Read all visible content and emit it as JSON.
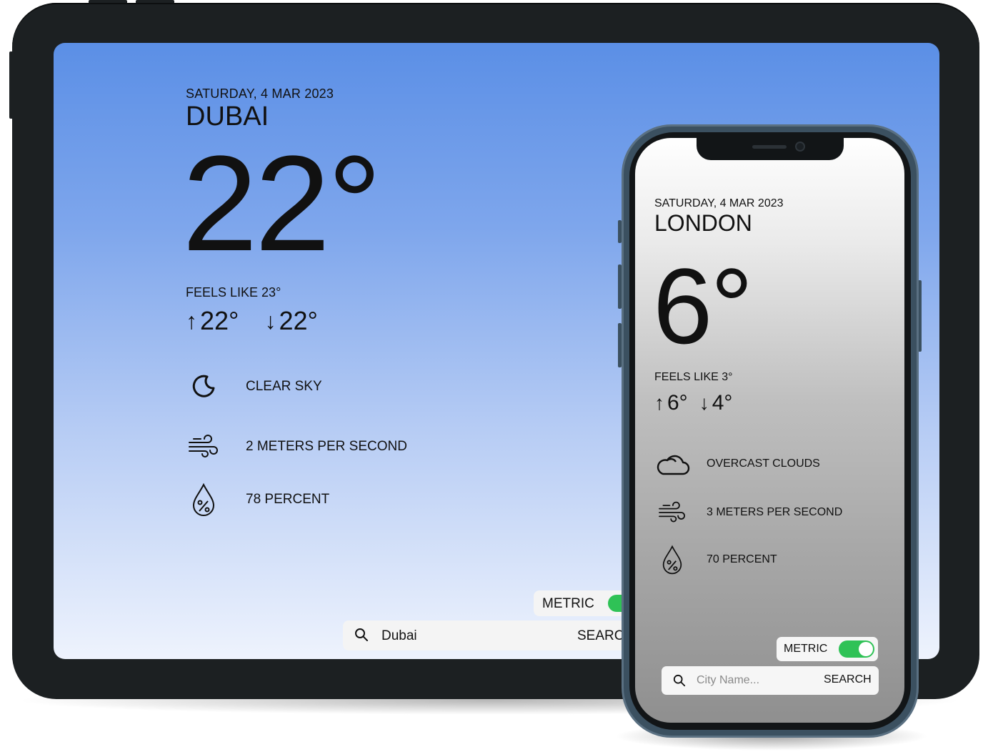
{
  "tablet": {
    "date": "SATURDAY, 4 MAR 2023",
    "city": "DUBAI",
    "temperature": "22°",
    "feels_like": "FEELS LIKE 23°",
    "high": "22°",
    "low": "22°",
    "conditions": [
      {
        "icon": "moon-icon",
        "label": "CLEAR SKY"
      },
      {
        "icon": "wind-icon",
        "label": "2 METERS PER SECOND"
      },
      {
        "icon": "humidity-drop-icon",
        "label": "78 PERCENT"
      }
    ],
    "units_label": "METRIC",
    "units_toggle_on": true,
    "search_value": "Dubai",
    "search_button": "SEARCH",
    "toggle_color": "#2fc256"
  },
  "phone": {
    "date": "SATURDAY, 4 MAR 2023",
    "city": "LONDON",
    "temperature": "6°",
    "feels_like": "FEELS LIKE 3°",
    "high": "6°",
    "low": "4°",
    "conditions": [
      {
        "icon": "cloud-icon",
        "label": "OVERCAST CLOUDS"
      },
      {
        "icon": "wind-icon",
        "label": "3 METERS PER SECOND"
      },
      {
        "icon": "humidity-drop-icon",
        "label": "70 PERCENT"
      }
    ],
    "units_label": "METRIC",
    "units_toggle_on": true,
    "search_placeholder": "City Name...",
    "search_button": "SEARCH",
    "toggle_color": "#2fc256"
  }
}
